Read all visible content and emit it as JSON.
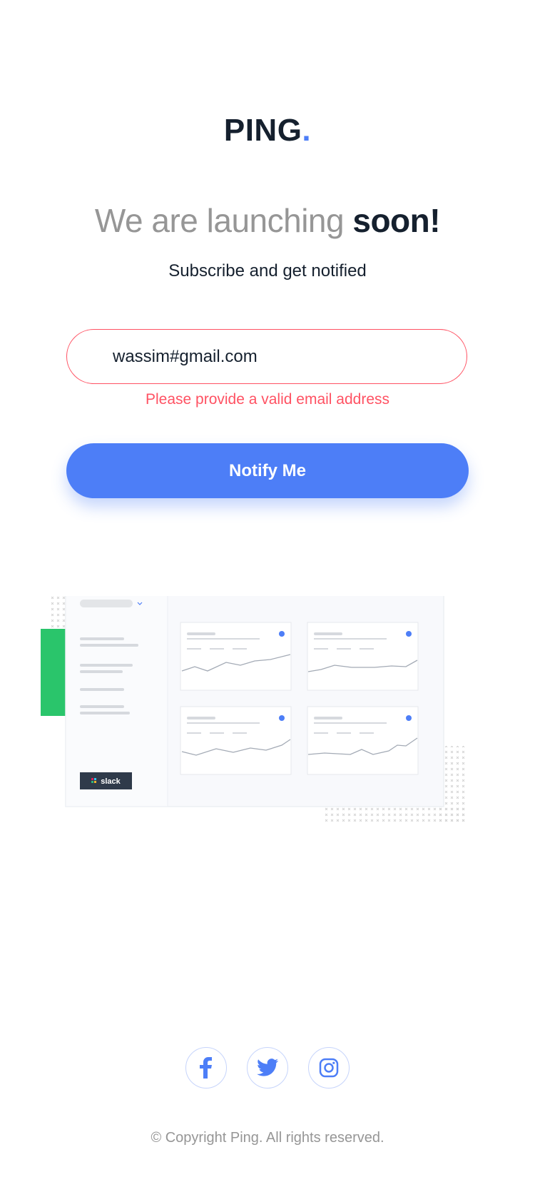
{
  "brand": {
    "name": "PING",
    "dot": "."
  },
  "hero": {
    "headline_light": "We are launching ",
    "headline_bold": "soon!",
    "subtitle": "Subscribe and get notified"
  },
  "form": {
    "email_value": "wassim#gmail.com",
    "error": "Please provide a valid email address",
    "button_label": "Notify Me"
  },
  "dashboard": {
    "slack_label": "slack",
    "dots": [
      "#2ac56b",
      "#4d7ef7",
      "#333333"
    ],
    "cards": 4
  },
  "social": [
    "facebook-icon",
    "twitter-icon",
    "instagram-icon"
  ],
  "footer": {
    "copyright": "© Copyright Ping. All rights reserved."
  },
  "colors": {
    "accent": "#4d7ef7",
    "error": "#ff5263",
    "dark": "#15202e",
    "gray": "#969696",
    "green": "#2ac56b"
  }
}
